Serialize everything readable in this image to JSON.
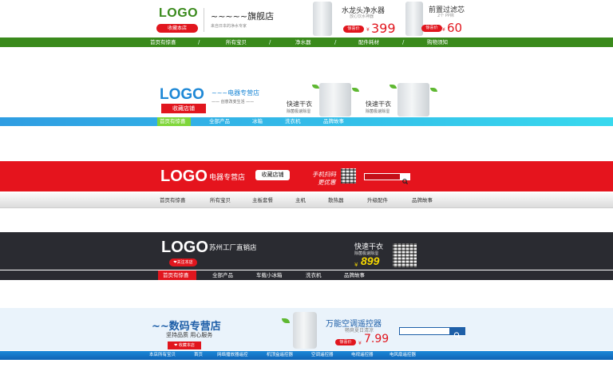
{
  "banner1": {
    "logo": "LOGO",
    "favorite_label": "收藏本店",
    "shop_name": "~~~~~旗舰店",
    "shop_tagline": "来自日本的净水专家",
    "product1": {
      "name": "水龙头净水器",
      "sub": "放心饮水神器",
      "tag": "惊喜价",
      "currency": "¥",
      "price": "399"
    },
    "product2": {
      "name": "前置过滤芯",
      "sub": "2个 PP棉",
      "tag": "惊喜价",
      "currency": "¥",
      "price": "60"
    },
    "nav": [
      "首页有惊喜",
      "所有宝贝",
      "净水器",
      "配件耗材",
      "购物须知"
    ],
    "nav_separator": "/",
    "colors": {
      "accent": "#3a8a1c",
      "red": "#e1161e"
    }
  },
  "banner2": {
    "logo": "LOGO",
    "favorite_label": "收藏店铺",
    "shop_name": "~~~电器专营店",
    "shop_tagline": "—— 创意改变生活 ——",
    "product1": {
      "text": "快速干衣",
      "sub": "除菌极速除湿"
    },
    "product2": {
      "text": "快速干衣",
      "sub": "除菌极速除湿"
    },
    "nav": [
      "首页有惊喜",
      "全部产品",
      "冰箱",
      "洗衣机",
      "品牌故事"
    ],
    "colors": {
      "accent": "#1e88d6",
      "active": "#7fd63a"
    }
  },
  "banner3": {
    "logo": "LOGO",
    "shop_name": "电器专营店",
    "favorite_label": "收藏店铺",
    "scan_text_1": "手机扫码",
    "scan_text_2": "更优惠",
    "search_icon": "search-icon",
    "nav": [
      "首页有惊喜",
      "所有宝贝",
      "主板套餐",
      "主机",
      "散热器",
      "升级配件",
      "品牌故事"
    ],
    "colors": {
      "accent": "#e5141d"
    }
  },
  "banner4": {
    "logo": "LOGO",
    "shop_name": "苏州工厂直销店",
    "favorite_label": "❤关注本店",
    "promo": "快速干衣",
    "promo_sub": "除菌极速除湿",
    "currency": "¥",
    "price": "899",
    "nav": [
      "首页有惊喜",
      "全部产品",
      "车载小冰箱",
      "洗衣机",
      "品牌故事"
    ],
    "colors": {
      "bg": "#2a2b31",
      "price": "#f5d700",
      "active": "#e1161e"
    }
  },
  "banner5": {
    "shop_name": "~~数码专营店",
    "tagline": "坚持品质 用心服务",
    "favorite_label": "❤ 收藏本店",
    "product_name": "万能空调遥控器",
    "product_sub": "畅爽夏日清凉",
    "tag": "惊喜价",
    "currency": "¥",
    "price": "7.99",
    "search_icon": "search-icon",
    "nav": [
      "本店所有宝贝",
      "首页",
      "网络播放器遥控",
      "机顶盒遥控器",
      "空调遥控器",
      "电视遥控器",
      "电风扇遥控器"
    ],
    "colors": {
      "accent": "#1e5fa8"
    }
  }
}
